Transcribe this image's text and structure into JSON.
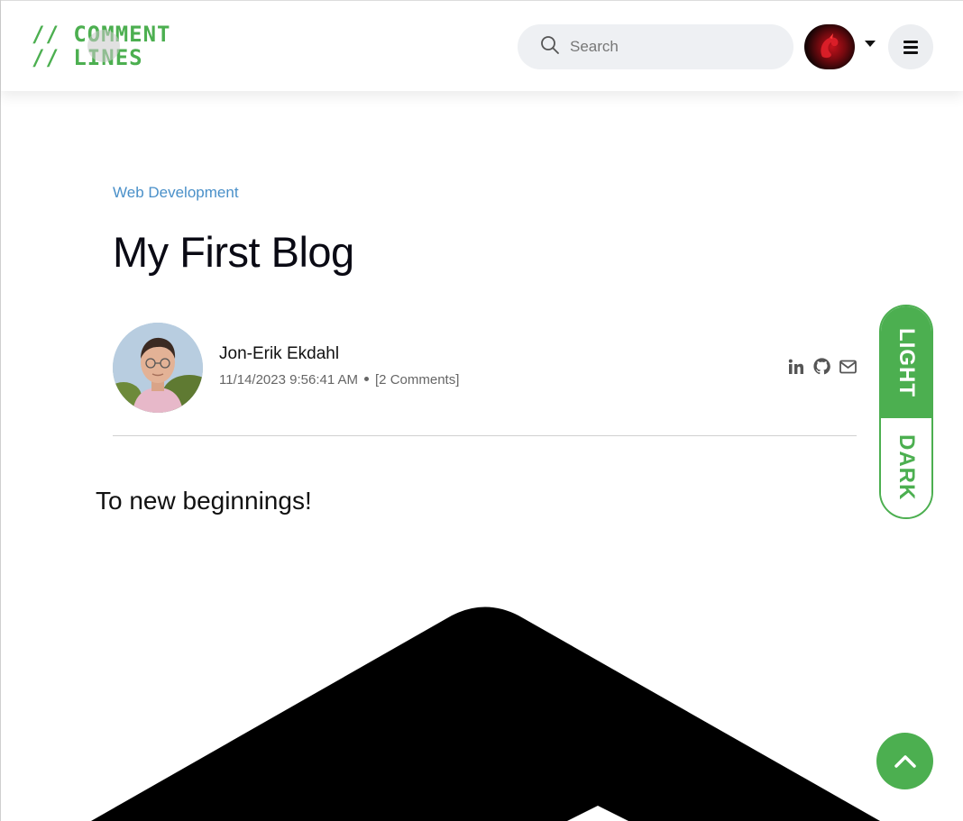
{
  "header": {
    "logo": {
      "line1": "// COMMENT",
      "line2": "// LINES"
    },
    "search": {
      "placeholder": "Search",
      "value": ""
    },
    "user_avatar_icon": "dragon-avatar-icon",
    "menu_icon": "hamburger-menu-icon"
  },
  "article": {
    "category": "Web Development",
    "title": "My First Blog",
    "author": {
      "name": "Jon-Erik Ekdahl",
      "date": "11/14/2023 9:56:41 AM",
      "comments": "[2 Comments]"
    },
    "socials": [
      "linkedin-icon",
      "github-icon",
      "envelope-icon"
    ],
    "body": "To new beginnings!"
  },
  "theme_toggle": {
    "light": "LIGHT",
    "dark": "DARK",
    "selected": "light"
  },
  "scroll_top_icon": "chevron-up-icon",
  "colors": {
    "accent": "#4caf50",
    "category_link": "#4a90c9",
    "text": "#111111"
  }
}
